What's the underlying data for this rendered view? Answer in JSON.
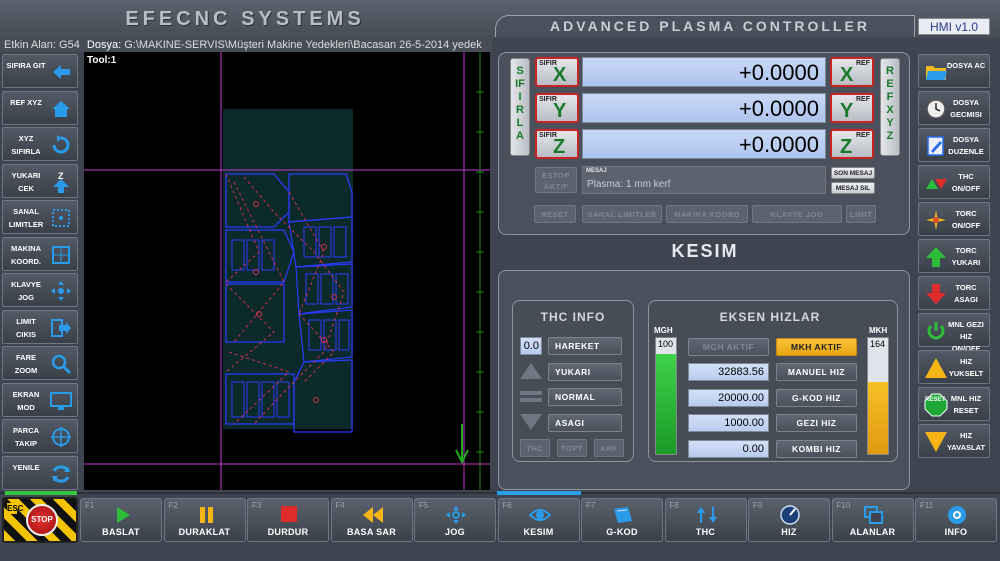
{
  "header": {
    "company": "EFECNC SYSTEMS",
    "controller_title": "ADVANCED PLASMA CONTROLLER",
    "version": "HMI v1.0"
  },
  "infobar": {
    "work_area_label": "Etkin Alan:",
    "work_area_value": "G54",
    "file_label": "Dosya:",
    "file_path": "G:\\MAKINE-SERVIS\\Müşteri Makine Yedekleri\\Bacasan 26-5-2014 yedek"
  },
  "left_buttons": [
    {
      "label": "SIFIRA GIT",
      "icon": "arrow-left-icon"
    },
    {
      "label": "REF XYZ",
      "icon": "home-icon"
    },
    {
      "label": "XYZ SIFIRLA",
      "icon": "reset-arrow-icon"
    },
    {
      "label": "YUKARI CEK",
      "icon": "z-up-icon"
    },
    {
      "label": "SANAL LIMITLER",
      "icon": "dotted-square-icon"
    },
    {
      "label": "MAKINA KOORD.",
      "icon": "grid-icon"
    },
    {
      "label": "KLAVYE JOG",
      "icon": "jog-arrows-icon"
    },
    {
      "label": "LIMIT CIKIS",
      "icon": "exit-arrow-icon"
    },
    {
      "label": "FARE ZOOM",
      "icon": "magnifier-icon"
    },
    {
      "label": "EKRAN MOD",
      "icon": "monitor-icon"
    },
    {
      "label": "PARCA TAKIP",
      "icon": "target-icon"
    },
    {
      "label": "YENILE",
      "icon": "refresh-icon"
    }
  ],
  "canvas": {
    "tool_label": "Tool:1"
  },
  "dro": {
    "sifirla_label": "SIFIRLA",
    "ref_xyz_label": "REF XYZ",
    "zero_prefix": "SIFIR",
    "ref_suffix": "REF",
    "axes": [
      {
        "axis": "X",
        "value": "+0.0000"
      },
      {
        "axis": "Y",
        "value": "+0.0000"
      },
      {
        "axis": "Z",
        "value": "+0.0000"
      }
    ],
    "estop_label": "ESTOP AKTIF",
    "message_title": "MESAJ",
    "message_text": "Plasma: 1 mm kerf",
    "last_message_btn": "SON MESAJ",
    "clear_message_btn": "MESAJ SIL",
    "status_buttons": [
      "RESET",
      "SANAL LIMITLER",
      "MAKINA KOORD",
      "KLAVYE JOG",
      "LIMIT"
    ]
  },
  "kesim": {
    "title": "KESIM",
    "thc_info": {
      "title": "THC INFO",
      "value": "0.0",
      "buttons": [
        "HAREKET",
        "YUKARI",
        "NORMAL",
        "ASAGI"
      ],
      "bottom_buttons": [
        "THC",
        "TOPT",
        "ARK"
      ]
    },
    "speeds": {
      "title": "EKSEN HIZLAR",
      "mgh_label": "MGH",
      "mgh_value": "100",
      "mgh_fraction": 0.86,
      "mkh_label": "MKH",
      "mkh_value": "164",
      "mkh_fraction": 0.62,
      "mgh_mode_btn": "MGH AKTIF",
      "mkh_mode_btn": "MKH AKTIF",
      "rows": [
        {
          "value": "32883.56",
          "label": "MANUEL HIZ"
        },
        {
          "value": "20000.00",
          "label": "G-KOD HIZ"
        },
        {
          "value": "1000.00",
          "label": "GEZI HIZ"
        },
        {
          "value": "0.00",
          "label": "KOMBI HIZ"
        }
      ]
    }
  },
  "right_buttons": [
    {
      "label": "DOSYA AC",
      "icon": "folder-icon"
    },
    {
      "label": "DOSYA GECMISI",
      "icon": "clock-icon"
    },
    {
      "label": "DOSYA DUZENLE",
      "icon": "edit-file-icon"
    },
    {
      "label": "THC ON/OFF",
      "icon": "thc-arrows-icon"
    },
    {
      "label": "TORC ON/OFF",
      "icon": "spark-icon"
    },
    {
      "label": "TORC YUKARI",
      "icon": "green-up-arrow-icon"
    },
    {
      "label": "TORC ASAGI",
      "icon": "red-down-arrow-icon"
    },
    {
      "label": "MNL GEZI HIZ ON/OFF",
      "icon": "power-icon"
    },
    {
      "label": "HIZ YUKSELT",
      "icon": "yellow-up-triangle-icon"
    },
    {
      "label": "MNL HIZ RESET",
      "icon": "reset-octagon-icon",
      "badge": "RESET"
    },
    {
      "label": "HIZ YAVASLAT",
      "icon": "yellow-down-triangle-icon"
    }
  ],
  "estop": {
    "esc_label": "ESC",
    "stop_label": "STOP"
  },
  "bottom_buttons": [
    {
      "fkey": "F1",
      "label": "BASLAT",
      "icon": "play-icon"
    },
    {
      "fkey": "F2",
      "label": "DURAKLAT",
      "icon": "pause-icon"
    },
    {
      "fkey": "F3",
      "label": "DURDUR",
      "icon": "stop-square-icon"
    },
    {
      "fkey": "F4",
      "label": "BASA SAR",
      "icon": "rewind-icon"
    },
    {
      "fkey": "F5",
      "label": "JOG",
      "icon": "jog-icon"
    },
    {
      "fkey": "F6",
      "label": "KESIM",
      "icon": "eye-icon"
    },
    {
      "fkey": "F7",
      "label": "G-KOD",
      "icon": "gcode-icon"
    },
    {
      "fkey": "F8",
      "label": "THC",
      "icon": "thc-icon"
    },
    {
      "fkey": "F9",
      "label": "HIZ",
      "icon": "speed-gauge-icon"
    },
    {
      "fkey": "F10",
      "label": "ALANLAR",
      "icon": "windows-icon"
    },
    {
      "fkey": "F11",
      "label": "INFO",
      "icon": "info-icon"
    }
  ],
  "colors": {
    "accent_green": "#1a7a2a",
    "dro_blue": "#aec4ee",
    "mkh_active": "#f2b21c",
    "mgh_bar": "#2ec23a",
    "mkh_bar": "#f5b517"
  }
}
